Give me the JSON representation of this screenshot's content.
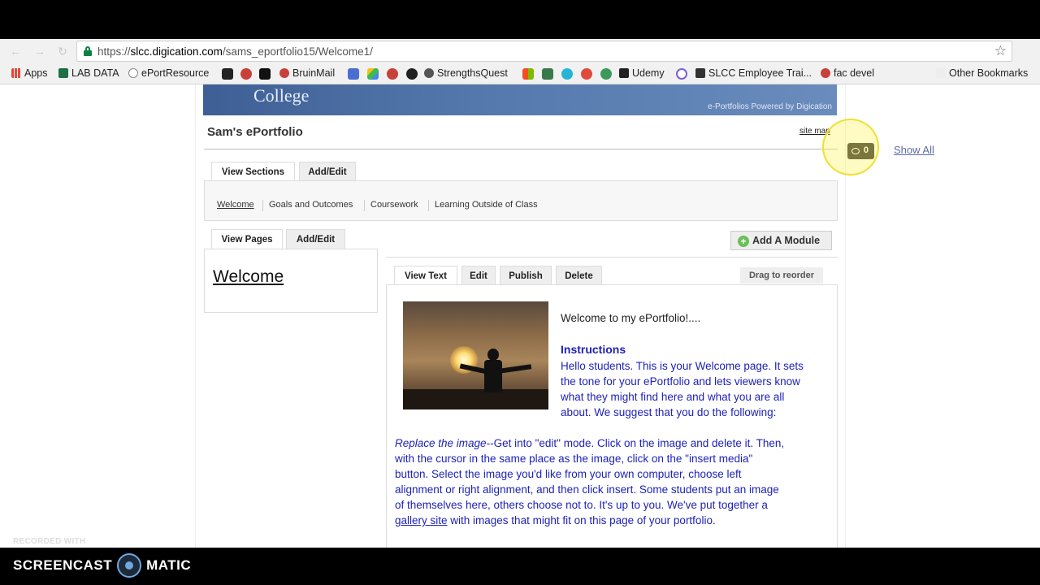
{
  "browser": {
    "url_prefix": "https://",
    "url_host": "slcc.digication.com",
    "url_path": "/sams_eportfolio15/Welcome1/",
    "bookmarks": {
      "apps": "Apps",
      "lab_data": "LAB DATA",
      "eportresource": "ePortResource",
      "bruinmail": "BruinMail",
      "strengthsquest": "StrengthsQuest",
      "udemy": "Udemy",
      "slcc_training": "SLCC Employee Trai...",
      "fac_devel": "fac devel",
      "other": "Other Bookmarks"
    }
  },
  "banner": {
    "college": "College",
    "powered": "e-Portfolios Powered by Digication"
  },
  "header": {
    "title": "Sam's ePortfolio",
    "site_map": "site map"
  },
  "viewer": {
    "count": "0",
    "show_all": "Show All"
  },
  "section_tabs": {
    "view": "View Sections",
    "edit": "Add/Edit",
    "items": [
      "Welcome",
      "Goals and Outcomes",
      "Coursework",
      "Learning Outside of Class"
    ]
  },
  "page_tabs": {
    "view": "View Pages",
    "edit": "Add/Edit",
    "current_page": "Welcome"
  },
  "module": {
    "add_button": "Add A Module",
    "tabs": [
      "View Text",
      "Edit",
      "Publish",
      "Delete"
    ],
    "drag": "Drag to reorder"
  },
  "content": {
    "welcome": "Welcome to my ePortfolio!....",
    "instructions_heading": "Instructions",
    "instructions_lines": [
      "Hello students. This is your Welcome page. It sets",
      "the tone for your ePortfolio and lets viewers know",
      "what they might find here and what you are all",
      "about. We suggest that you do the following:"
    ],
    "replace_em": "Replace the image",
    "replace_rest": "--Get into \"edit\" mode. Click on the image and delete it. Then,",
    "para_lines": [
      "with the cursor in the same place as the image, click on the \"insert media\"",
      "button. Select the image you'd like from your own computer, choose left",
      "alignment or right alignment, and then click insert. Some students put an image",
      "of themselves here, others choose not to. It's up to you. We've put together a"
    ],
    "gallery_link": "gallery site",
    "gallery_rest": " with images that might fit on this page of your portfolio."
  },
  "recorder": {
    "recorded_with": "RECORDED WITH",
    "brand_left": "SCREENCAST",
    "brand_right": "MATIC"
  }
}
